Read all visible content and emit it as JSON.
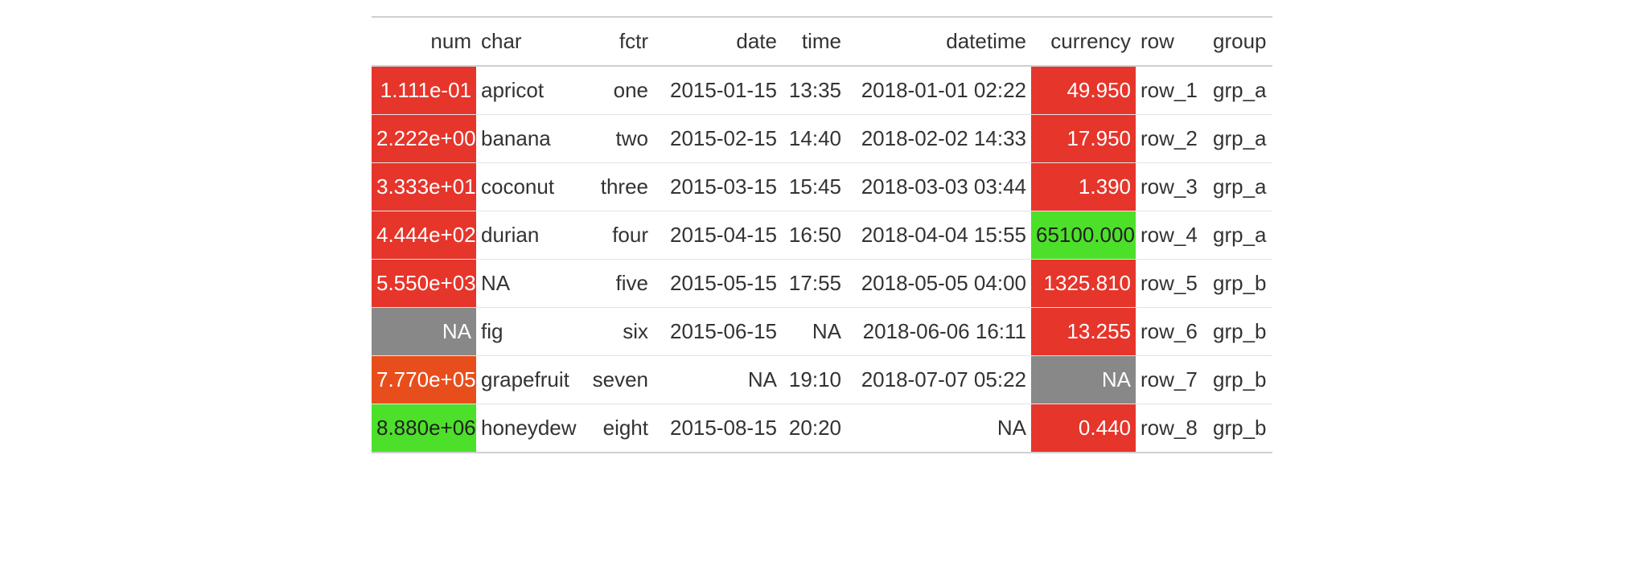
{
  "columns": {
    "num": {
      "label": "num",
      "align": "right"
    },
    "char": {
      "label": "char",
      "align": "left"
    },
    "fctr": {
      "label": "fctr",
      "align": "right"
    },
    "date": {
      "label": "date",
      "align": "right"
    },
    "time": {
      "label": "time",
      "align": "right"
    },
    "datetime": {
      "label": "datetime",
      "align": "right"
    },
    "currency": {
      "label": "currency",
      "align": "right"
    },
    "row": {
      "label": "row",
      "align": "left"
    },
    "group": {
      "label": "group",
      "align": "left"
    }
  },
  "colors": {
    "red": "#e6352b",
    "orange": "#e84e1c",
    "green": "#4de02a",
    "gray": "#888888"
  },
  "rows": [
    {
      "num": {
        "text": "1.111e-01",
        "bg": "red"
      },
      "char": {
        "text": "apricot"
      },
      "fctr": {
        "text": "one"
      },
      "date": {
        "text": "2015-01-15"
      },
      "time": {
        "text": "13:35"
      },
      "datetime": {
        "text": "2018-01-01 02:22"
      },
      "currency": {
        "text": "49.950",
        "bg": "red"
      },
      "row": {
        "text": "row_1"
      },
      "group": {
        "text": "grp_a"
      }
    },
    {
      "num": {
        "text": "2.222e+00",
        "bg": "red"
      },
      "char": {
        "text": "banana"
      },
      "fctr": {
        "text": "two"
      },
      "date": {
        "text": "2015-02-15"
      },
      "time": {
        "text": "14:40"
      },
      "datetime": {
        "text": "2018-02-02 14:33"
      },
      "currency": {
        "text": "17.950",
        "bg": "red"
      },
      "row": {
        "text": "row_2"
      },
      "group": {
        "text": "grp_a"
      }
    },
    {
      "num": {
        "text": "3.333e+01",
        "bg": "red"
      },
      "char": {
        "text": "coconut"
      },
      "fctr": {
        "text": "three"
      },
      "date": {
        "text": "2015-03-15"
      },
      "time": {
        "text": "15:45"
      },
      "datetime": {
        "text": "2018-03-03 03:44"
      },
      "currency": {
        "text": "1.390",
        "bg": "red"
      },
      "row": {
        "text": "row_3"
      },
      "group": {
        "text": "grp_a"
      }
    },
    {
      "num": {
        "text": "4.444e+02",
        "bg": "red"
      },
      "char": {
        "text": "durian"
      },
      "fctr": {
        "text": "four"
      },
      "date": {
        "text": "2015-04-15"
      },
      "time": {
        "text": "16:50"
      },
      "datetime": {
        "text": "2018-04-04 15:55"
      },
      "currency": {
        "text": "65100.000",
        "bg": "green"
      },
      "row": {
        "text": "row_4"
      },
      "group": {
        "text": "grp_a"
      }
    },
    {
      "num": {
        "text": "5.550e+03",
        "bg": "red"
      },
      "char": {
        "text": "NA"
      },
      "fctr": {
        "text": "five"
      },
      "date": {
        "text": "2015-05-15"
      },
      "time": {
        "text": "17:55"
      },
      "datetime": {
        "text": "2018-05-05 04:00"
      },
      "currency": {
        "text": "1325.810",
        "bg": "red"
      },
      "row": {
        "text": "row_5"
      },
      "group": {
        "text": "grp_b"
      }
    },
    {
      "num": {
        "text": "NA",
        "bg": "gray"
      },
      "char": {
        "text": "fig"
      },
      "fctr": {
        "text": "six"
      },
      "date": {
        "text": "2015-06-15"
      },
      "time": {
        "text": "NA"
      },
      "datetime": {
        "text": "2018-06-06 16:11"
      },
      "currency": {
        "text": "13.255",
        "bg": "red"
      },
      "row": {
        "text": "row_6"
      },
      "group": {
        "text": "grp_b"
      }
    },
    {
      "num": {
        "text": "7.770e+05",
        "bg": "orange"
      },
      "char": {
        "text": "grapefruit"
      },
      "fctr": {
        "text": "seven"
      },
      "date": {
        "text": "NA"
      },
      "time": {
        "text": "19:10"
      },
      "datetime": {
        "text": "2018-07-07 05:22"
      },
      "currency": {
        "text": "NA",
        "bg": "gray"
      },
      "row": {
        "text": "row_7"
      },
      "group": {
        "text": "grp_b"
      }
    },
    {
      "num": {
        "text": "8.880e+06",
        "bg": "green"
      },
      "char": {
        "text": "honeydew"
      },
      "fctr": {
        "text": "eight"
      },
      "date": {
        "text": "2015-08-15"
      },
      "time": {
        "text": "20:20"
      },
      "datetime": {
        "text": "NA"
      },
      "currency": {
        "text": "0.440",
        "bg": "red"
      },
      "row": {
        "text": "row_8"
      },
      "group": {
        "text": "grp_b"
      }
    }
  ]
}
